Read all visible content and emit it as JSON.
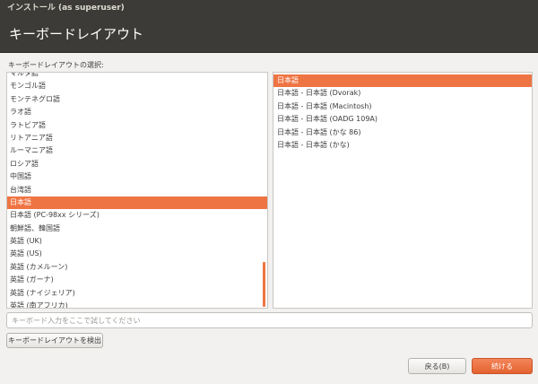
{
  "window": {
    "title": "インストール (as superuser)",
    "heading": "キーボードレイアウト"
  },
  "layouts": {
    "label": "キーボードレイアウトの選択:",
    "items": [
      "マルタ語",
      "モンゴル語",
      "モンテネグロ語",
      "ラオ語",
      "ラトビア語",
      "リトアニア語",
      "ルーマニア語",
      "ロシア語",
      "中国語",
      "台湾語",
      "日本語",
      "日本語 (PC-98xx シリーズ)",
      "朝鮮語、韓国語",
      "英語 (UK)",
      "英語 (US)",
      "英語 (カメルーン)",
      "英語 (ガーナ)",
      "英語 (ナイジェリア)",
      "英語 (南アフリカ)"
    ],
    "selected": "日本語"
  },
  "variants": {
    "items": [
      "日本語",
      "日本語 - 日本語 (Dvorak)",
      "日本語 - 日本語 (Macintosh)",
      "日本語 - 日本語 (OADG 109A)",
      "日本語 - 日本語 (かな 86)",
      "日本語 - 日本語 (かな)"
    ],
    "selected": "日本語"
  },
  "test_input": {
    "value": "",
    "placeholder": "キーボード入力をここで試してください"
  },
  "buttons": {
    "detect": "キーボードレイアウトを検出",
    "back": "戻る(B)",
    "continue": "続ける"
  },
  "colors": {
    "accent": "#ef7443",
    "header_bg": "#3c3b37",
    "window_bg": "#f2f1f0"
  }
}
